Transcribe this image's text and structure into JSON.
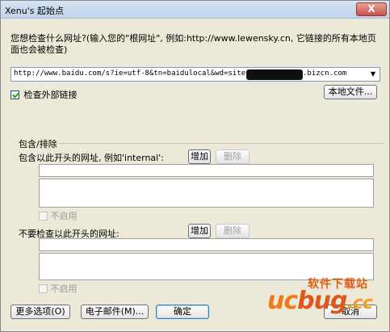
{
  "window": {
    "title": "Xenu's 起始点",
    "close_label": "X"
  },
  "intro": {
    "text": "您想检查什么网址?(输入您的\"根网址\", 例如:http://www.lewensky.cn, 它链接的所有本地页面也会被检查)"
  },
  "url_input": {
    "value_prefix": "http://www.baidu.com/s?ie=utf-8&tn=baidulocal&wd=site",
    "value_suffix": ".bizcn.com"
  },
  "options": {
    "check_external_label": "检查外部链接",
    "check_external_checked": true,
    "local_file_button": "本地文件..."
  },
  "include_exclude": {
    "group_title": "包含/排除",
    "include": {
      "label": "包含以此开头的网址, 例如'internal':",
      "add_button": "增加",
      "delete_button": "删除",
      "disable_label": "不启用"
    },
    "exclude": {
      "label": "不要检查以此开头的网址:",
      "add_button": "增加",
      "delete_button": "删除",
      "disable_label": "不启用"
    }
  },
  "footer": {
    "more_options": "更多选项(O)",
    "email": "电子邮件(M)...",
    "ok": "确定",
    "cancel": "取消"
  },
  "watermark": {
    "top_text": "软件下载站",
    "uc": "uc",
    "bug": "bug",
    "cc": ".cc"
  }
}
